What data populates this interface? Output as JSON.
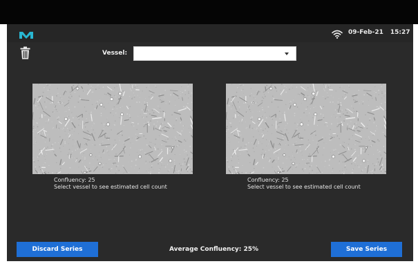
{
  "status_bar": {
    "logo": "m-logo-icon",
    "wifi": "wifi-icon",
    "date": "09-Feb-21",
    "time": "15:27"
  },
  "toolbar": {
    "trash_icon": "trash-icon",
    "vessel_label": "Vessel:",
    "vessel_value": ""
  },
  "images": [
    {
      "confluency": "Confluency: 25",
      "hint": "Select vessel to see estimated cell count"
    },
    {
      "confluency": "Confluency: 25",
      "hint": "Select vessel to see estimated cell count"
    }
  ],
  "footer": {
    "discard_label": "Discard Series",
    "average_label": "Average Confluency: 25%",
    "save_label": "Save Series"
  },
  "colors": {
    "background": "#2a2a2a",
    "accent": "#1f6fd6",
    "logo": "#29b6d1"
  }
}
